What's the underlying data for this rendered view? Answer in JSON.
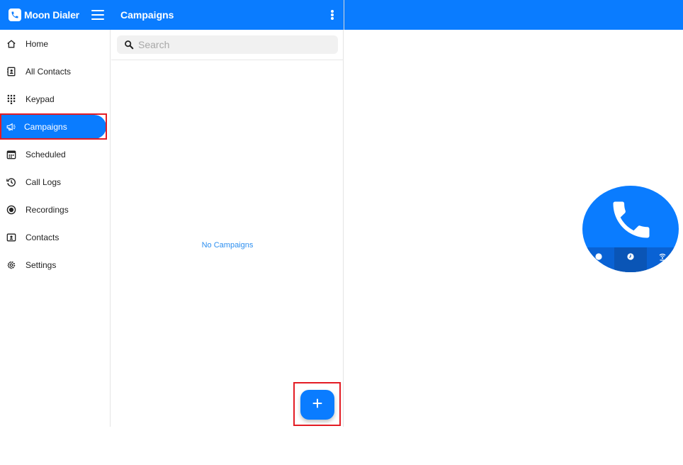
{
  "app": {
    "name": "Moon Dialer",
    "brand_color": "#0a7cff"
  },
  "sidebar": {
    "items": [
      {
        "label": "Home",
        "icon": "home-icon"
      },
      {
        "label": "All Contacts",
        "icon": "contacts-book-icon"
      },
      {
        "label": "Keypad",
        "icon": "keypad-icon"
      },
      {
        "label": "Campaigns",
        "icon": "megaphone-icon",
        "active": true
      },
      {
        "label": "Scheduled",
        "icon": "calendar-icon"
      },
      {
        "label": "Call Logs",
        "icon": "history-icon"
      },
      {
        "label": "Recordings",
        "icon": "record-icon"
      },
      {
        "label": "Contacts",
        "icon": "contact-card-icon"
      },
      {
        "label": "Settings",
        "icon": "gear-icon"
      }
    ]
  },
  "panel": {
    "title": "Campaigns",
    "search_placeholder": "Search",
    "empty_message": "No Campaigns",
    "add_button_icon": "plus-icon"
  },
  "call_widget": {
    "icons": [
      "phone-icon",
      "record-dot-icon",
      "clock-icon",
      "signal-icon"
    ]
  }
}
